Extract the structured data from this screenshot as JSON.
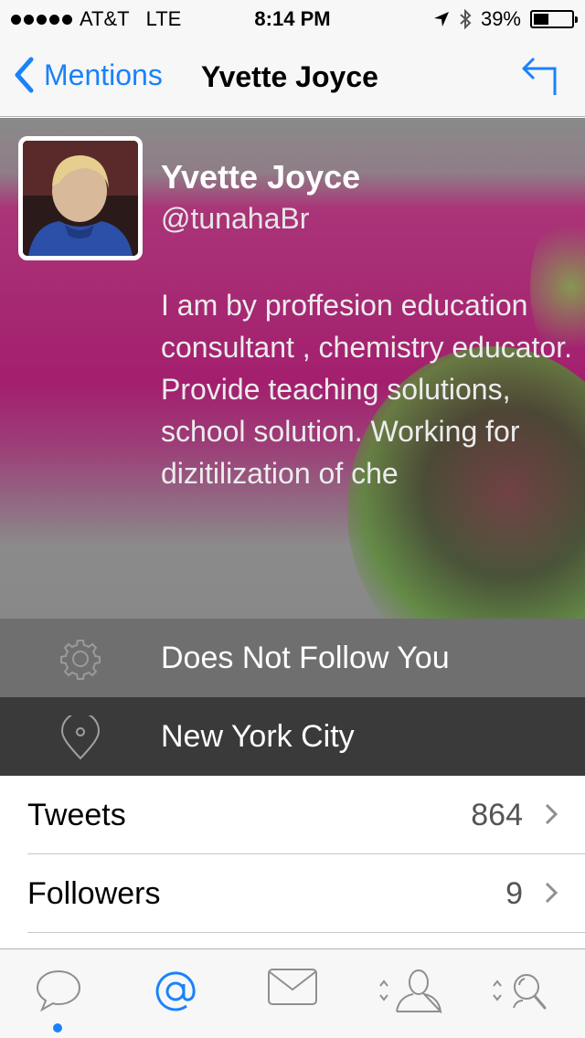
{
  "status_bar": {
    "carrier": "AT&T",
    "network": "LTE",
    "time": "8:14 PM",
    "battery": "39%",
    "battery_level": 0.39
  },
  "nav": {
    "back_label": "Mentions",
    "title": "Yvette Joyce"
  },
  "profile": {
    "name": "Yvette Joyce",
    "handle": "@tunahaBr",
    "bio": "I am by proffesion education consultant , chemistry educator. Provide teaching solutions, school solution. Working for dizitilization of che",
    "follow_status": "Does Not Follow You",
    "location": "New York City"
  },
  "stats": [
    {
      "label": "Tweets",
      "count": "864"
    },
    {
      "label": "Followers",
      "count": "9"
    }
  ],
  "tabs": [
    {
      "name": "timeline-icon",
      "active": false
    },
    {
      "name": "mentions-icon",
      "active": true
    },
    {
      "name": "messages-icon",
      "active": false
    },
    {
      "name": "profile-icon",
      "active": false
    },
    {
      "name": "search-icon",
      "active": false
    }
  ],
  "colors": {
    "accent": "#1a82fb",
    "follow_row": "#6f6f6f",
    "location_row": "#3a3a3a"
  }
}
